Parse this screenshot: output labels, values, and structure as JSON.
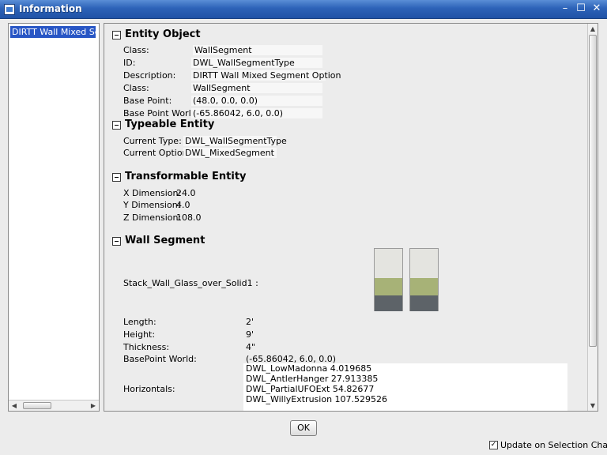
{
  "window": {
    "title": "Information",
    "controls": {
      "minimize": "–",
      "maximize": "☐",
      "close": "✕"
    }
  },
  "tree": {
    "selected_item": "DIRTT Wall Mixed Segment"
  },
  "sections": {
    "entity_object": {
      "title": "Entity Object",
      "rows": [
        {
          "label": "Class:",
          "value": "WallSegment"
        },
        {
          "label": "ID:",
          "value": "DWL_WallSegmentType"
        },
        {
          "label": "Description:",
          "value": "DIRTT Wall Mixed Segment Option"
        },
        {
          "label": "Class:",
          "value": "WallSegment"
        },
        {
          "label": "Base Point:",
          "value": "(48.0, 0.0, 0.0)"
        },
        {
          "label": "Base Point World:",
          "value": "(-65.86042, 6.0, 0.0)"
        }
      ]
    },
    "typeable_entity": {
      "title": "Typeable Entity",
      "rows": [
        {
          "label": "Current Type:",
          "value": "DWL_WallSegmentType"
        },
        {
          "label": "Current Option:",
          "value": "DWL_MixedSegment"
        }
      ]
    },
    "transformable_entity": {
      "title": "Transformable Entity",
      "rows": [
        {
          "label": "X Dimension:",
          "value": "24.0"
        },
        {
          "label": "Y Dimension:",
          "value": "4.0"
        },
        {
          "label": "Z Dimension:",
          "value": "108.0"
        }
      ]
    },
    "wall_segment": {
      "title": "Wall Segment",
      "stack_label": "Stack_Wall_Glass_over_Solid1 :",
      "rows": [
        {
          "label": "Length:",
          "value": "2'"
        },
        {
          "label": "Height:",
          "value": "9'"
        },
        {
          "label": "Thickness:",
          "value": "4\""
        },
        {
          "label": "BasePoint World:",
          "value": "(-65.86042, 6.0, 0.0)"
        }
      ],
      "horizontals_label": "Horizontals:",
      "horizontals": [
        "DWL_LowMadonna 4.019685",
        "DWL_AntlerHanger 27.913385",
        "DWL_PartialUFOExt 54.82677",
        "DWL_WillyExtrusion 107.529526"
      ]
    }
  },
  "footer": {
    "ok_label": "OK",
    "update_checkbox_label": "Update on Selection Change",
    "update_checkbox_checked": true,
    "check_glyph": "✓"
  },
  "scrollbar_arrows": {
    "up": "▲",
    "down": "▼",
    "left": "◀",
    "right": "▶"
  },
  "colors": {
    "selection": "#2856c5",
    "glass": "#e4e4e0",
    "olive": "#a7b277",
    "solid": "#5d6368"
  }
}
